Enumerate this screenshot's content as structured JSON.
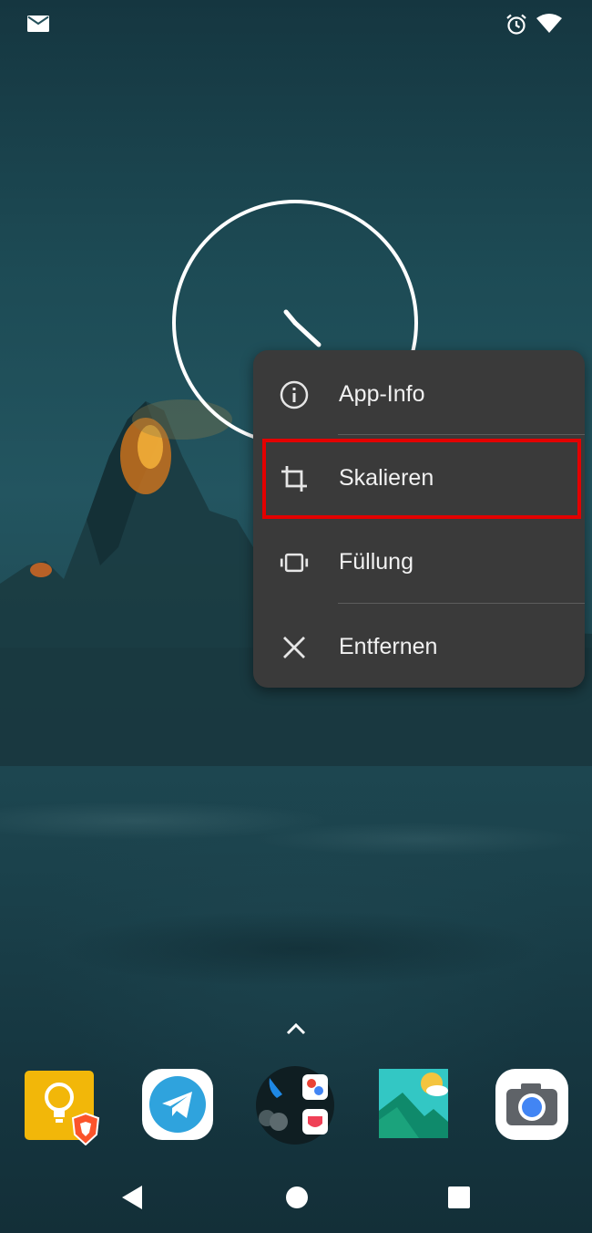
{
  "status_bar": {
    "icons": [
      "mail-icon",
      "alarm-icon",
      "wifi-icon"
    ]
  },
  "clock_widget": {
    "type": "analog-clock"
  },
  "context_menu": {
    "items": [
      {
        "label": "App-Info",
        "icon": "info-icon"
      },
      {
        "label": "Skalieren",
        "icon": "crop-icon",
        "highlighted": true
      },
      {
        "label": "Füllung",
        "icon": "fill-icon"
      },
      {
        "label": "Entfernen",
        "icon": "close-icon"
      }
    ],
    "highlight_color": "#e30000"
  },
  "dock": {
    "apps": [
      {
        "name": "keep-brave-app",
        "icon": "lightbulb-icon",
        "badge": "brave-icon"
      },
      {
        "name": "telegram-app",
        "icon": "telegram-icon"
      },
      {
        "name": "app-folder",
        "icon": "folder-icon"
      },
      {
        "name": "gallery-app",
        "icon": "gallery-icon"
      },
      {
        "name": "camera-app",
        "icon": "camera-icon"
      }
    ]
  },
  "nav_bar": {
    "buttons": [
      "back-icon",
      "home-icon",
      "recents-icon"
    ]
  },
  "colors": {
    "menu_background": "#3a3a3a",
    "menu_text": "#f1f1f1",
    "wallpaper_teal": "#235560"
  }
}
